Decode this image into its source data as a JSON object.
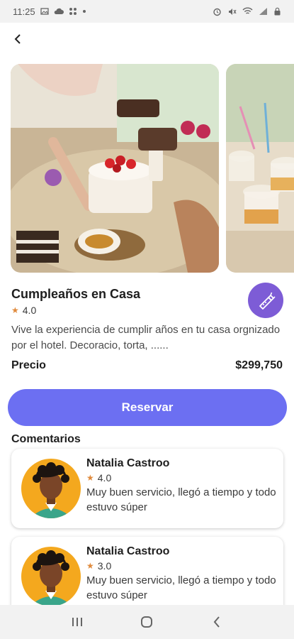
{
  "status_bar": {
    "time": "11:25",
    "left_icons": [
      "image-icon",
      "cloud-icon",
      "grid-icon",
      "dot-icon"
    ],
    "right_icons": [
      "alarm-icon",
      "mute-icon",
      "wifi-icon",
      "signal-icon",
      "lock-icon"
    ]
  },
  "event": {
    "title": "Cumpleaños en Casa",
    "rating": "4.0",
    "description": "Vive la experiencia de cumplir años en tu casa orgnizado por el hotel. Decoracio, torta, ......",
    "category_icon": "party-popper-icon",
    "photos": [
      "birthday-cake-table-photo",
      "dessert-cups-photo"
    ]
  },
  "price": {
    "label": "Precio",
    "value": "$299,750"
  },
  "reserve_button": {
    "label": "Reservar"
  },
  "comments": {
    "title": "Comentarios",
    "items": [
      {
        "name": "Natalia Castroo",
        "rating": "4.0",
        "text": "Muy buen servicio, llegó a tiempo y todo estuvo súper"
      },
      {
        "name": "Natalia Castroo",
        "rating": "3.0",
        "text": "Muy buen servicio, llegó a tiempo y todo estuvo súper"
      }
    ]
  },
  "colors": {
    "accent": "#6c6ff2",
    "badge": "#7d5cd6",
    "star": "#e08a3c",
    "avatar_bg": "#f4a81e"
  }
}
